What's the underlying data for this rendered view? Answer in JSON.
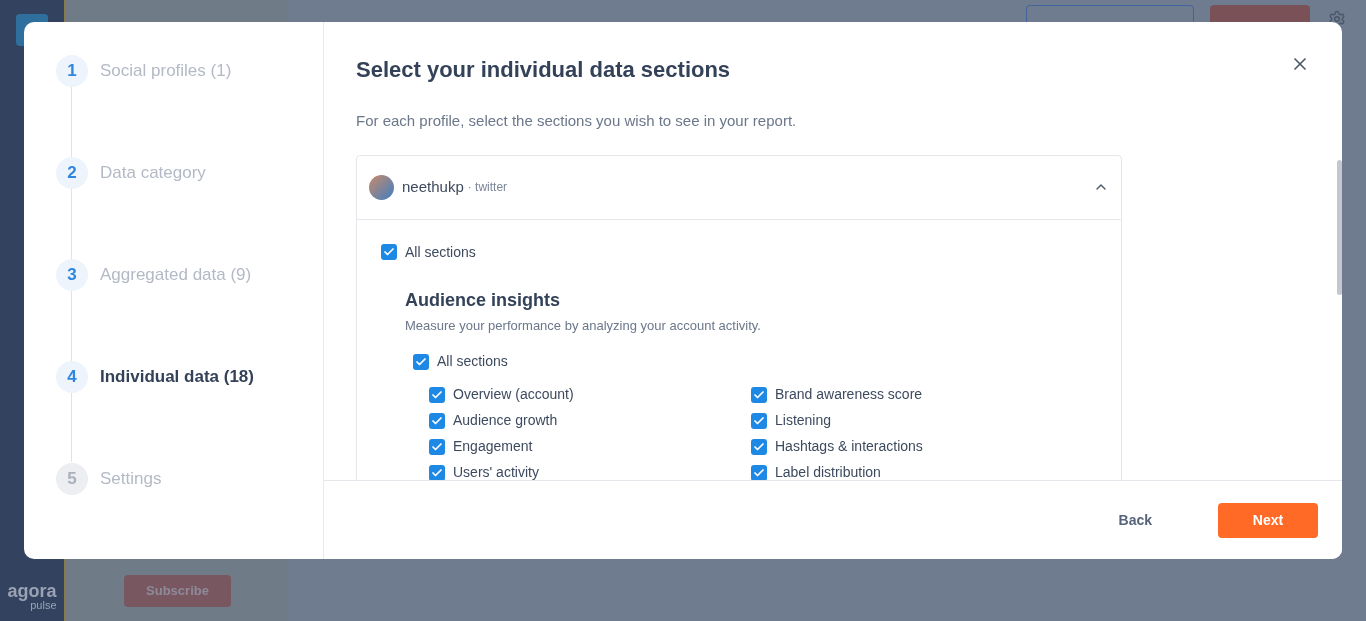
{
  "background": {
    "subscribe_button": "Subscribe",
    "logo": {
      "name": "agora",
      "tagline": "pulse"
    }
  },
  "steps": [
    {
      "number": "1",
      "label": "Social profiles (1)",
      "completed": true,
      "selected": false
    },
    {
      "number": "2",
      "label": "Data category",
      "completed": true,
      "selected": false
    },
    {
      "number": "3",
      "label": "Aggregated data (9)",
      "completed": true,
      "selected": false
    },
    {
      "number": "4",
      "label": "Individual data (18)",
      "completed": true,
      "selected": true
    },
    {
      "number": "5",
      "label": "Settings",
      "completed": false,
      "selected": false
    }
  ],
  "title": "Select your individual data sections",
  "subtitle": "For each profile, select the sections you wish to see in your report.",
  "profile": {
    "name": "neethukp",
    "network": "· twitter",
    "expanded": true,
    "all_sections": {
      "label": "All sections",
      "checked": true
    },
    "groups": [
      {
        "title": "Audience insights",
        "description": "Measure your performance by analyzing your account activity.",
        "all_sections": {
          "label": "All sections",
          "checked": true
        },
        "items": [
          {
            "label": "Overview (account)",
            "checked": true
          },
          {
            "label": "Brand awareness score",
            "checked": true
          },
          {
            "label": "Audience growth",
            "checked": true
          },
          {
            "label": "Listening",
            "checked": true
          },
          {
            "label": "Engagement",
            "checked": true
          },
          {
            "label": "Hashtags & interactions",
            "checked": true
          },
          {
            "label": "Users' activity",
            "checked": true
          },
          {
            "label": "Label distribution",
            "checked": true
          }
        ]
      }
    ]
  },
  "footer": {
    "back": "Back",
    "next": "Next"
  }
}
